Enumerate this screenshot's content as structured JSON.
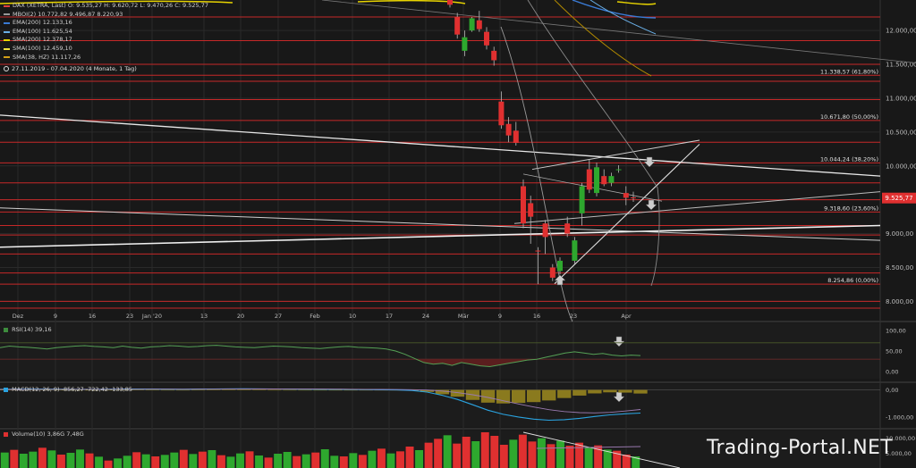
{
  "legend": [
    {
      "label": "DAX (XETRA, Last)  O: 9.535,27  H: 9.620,72  L: 9.470,26  C: 9.525,77",
      "color": "#e04040"
    },
    {
      "label": "MBOI(2)  10.772,82  9.496,87  8.220,93",
      "color": "#999999"
    },
    {
      "label": "EMA(200)  12.133,16",
      "color": "#3a7bd5"
    },
    {
      "label": "EMA(100)  11.625,54",
      "color": "#6ab0e8"
    },
    {
      "label": "SMA(200)  12.378,17",
      "color": "#e8d400"
    },
    {
      "label": "SMA(100)  12.459,10",
      "color": "#f0e040"
    },
    {
      "label": "SMA(38, HZ)  11.117,26",
      "color": "#d4a017"
    }
  ],
  "range_text": "27.11.2019 - 07.04.2020  (4 Monate, 1 Tag)",
  "fib_labels": [
    {
      "text": "11.338,57 (61,80%)",
      "y": 11338.57
    },
    {
      "text": "10.671,80 (50,00%)",
      "y": 10671.8
    },
    {
      "text": "10.044,24 (38,20%)",
      "y": 10044.24
    },
    {
      "text": "9.318,60 (23,60%)",
      "y": 9318.6
    },
    {
      "text": "8.254,86 (0,00%)",
      "y": 8254.86
    }
  ],
  "last_price": {
    "text": "9.525,77",
    "value": 9525.77
  },
  "rsi_title": "RSI(14)  39,16",
  "macd_title": "MACD(12, 26, 9)  -856,27  -722,42  -133,85",
  "volume_title": "Volume(10)  3,86G  7,48G",
  "watermark": "Trading-Portal.NET",
  "colors": {
    "up": "#2ea82e",
    "down": "#e03030",
    "bg": "#181818",
    "grid": "#2a2a2a",
    "hline": "#c62828"
  },
  "chart_data": [
    {
      "type": "candlestick",
      "title": "DAX (XETRA, Last)",
      "x_tick_labels": [
        "Dez",
        "9",
        "16",
        "23",
        "Jan '20",
        "13",
        "20",
        "27",
        "Feb",
        "10",
        "17",
        "24",
        "Mär",
        "9",
        "16",
        "23",
        "Apr"
      ],
      "y_ticks": [
        8000,
        8500,
        9000,
        9500,
        10000,
        10500,
        11000,
        11500,
        12000
      ],
      "y_tick_labels": [
        "8.000,00",
        "8.500,00",
        "9.000,00",
        "9.500,00",
        "10.000,00",
        "10.500,00",
        "11.000,00",
        "11.500,00",
        "12.000,00"
      ],
      "ylim": [
        7900,
        12450
      ],
      "candles": [
        {
          "o": 12510,
          "h": 12560,
          "l": 12340,
          "c": 12380
        },
        {
          "o": 12200,
          "h": 12260,
          "l": 11880,
          "c": 11940
        },
        {
          "o": 11700,
          "h": 12000,
          "l": 11620,
          "c": 11900
        },
        {
          "o": 12000,
          "h": 12200,
          "l": 11980,
          "c": 12180
        },
        {
          "o": 12150,
          "h": 12290,
          "l": 11980,
          "c": 12020
        },
        {
          "o": 11980,
          "h": 12050,
          "l": 11720,
          "c": 11780
        },
        {
          "o": 11700,
          "h": 11760,
          "l": 11480,
          "c": 11560
        },
        {
          "o": 10950,
          "h": 11100,
          "l": 10550,
          "c": 10600
        },
        {
          "o": 10620,
          "h": 10720,
          "l": 10350,
          "c": 10450
        },
        {
          "o": 10520,
          "h": 10650,
          "l": 10300,
          "c": 10340
        },
        {
          "o": 9700,
          "h": 9800,
          "l": 9080,
          "c": 9150
        },
        {
          "o": 9450,
          "h": 9560,
          "l": 8850,
          "c": 9250
        },
        {
          "o": 8750,
          "h": 8800,
          "l": 8255,
          "c": 8740
        },
        {
          "o": 9150,
          "h": 9200,
          "l": 8700,
          "c": 8950
        },
        {
          "o": 8500,
          "h": 8550,
          "l": 8300,
          "c": 8350
        },
        {
          "o": 8450,
          "h": 8650,
          "l": 8400,
          "c": 8600
        },
        {
          "o": 9150,
          "h": 9250,
          "l": 8950,
          "c": 9000
        },
        {
          "o": 8600,
          "h": 8950,
          "l": 8550,
          "c": 8900
        },
        {
          "o": 9300,
          "h": 9750,
          "l": 9120,
          "c": 9700
        },
        {
          "o": 9950,
          "h": 10100,
          "l": 9600,
          "c": 9650
        },
        {
          "o": 9600,
          "h": 10050,
          "l": 9550,
          "c": 9980
        },
        {
          "o": 9850,
          "h": 9950,
          "l": 9700,
          "c": 9730
        },
        {
          "o": 9750,
          "h": 9900,
          "l": 9700,
          "c": 9850
        },
        {
          "o": 9950,
          "h": 10010,
          "l": 9900,
          "c": 9950
        },
        {
          "o": 9600,
          "h": 9700,
          "l": 9420,
          "c": 9530
        },
        {
          "o": 9535,
          "h": 9620,
          "l": 9470,
          "c": 9525
        }
      ],
      "horizontal_levels": [
        12200,
        11850,
        11500,
        11338.57,
        11250,
        10980,
        10671.8,
        10350,
        10044.24,
        9750,
        9500,
        9318.6,
        9120,
        8980,
        8700,
        8420,
        8254.86,
        8000,
        7900
      ]
    },
    {
      "type": "line",
      "title": "RSI(14)",
      "y_tick_labels": [
        "100,00",
        "50,00",
        "0,00"
      ],
      "ylim": [
        0,
        100
      ],
      "series": [
        {
          "name": "RSI(14)",
          "values": [
            58,
            62,
            60,
            59,
            57,
            55,
            58,
            60,
            62,
            63,
            61,
            60,
            58,
            62,
            59,
            57,
            60,
            61,
            63,
            62,
            60,
            61,
            63,
            64,
            62,
            60,
            59,
            58,
            60,
            62,
            61,
            60,
            58,
            57,
            56,
            58,
            60,
            61,
            59,
            58,
            57,
            55,
            50,
            42,
            32,
            22,
            18,
            20,
            15,
            22,
            18,
            14,
            12,
            16,
            20,
            24,
            28,
            30,
            35,
            40,
            45,
            48,
            45,
            42,
            44,
            40,
            38,
            40,
            39
          ]
        }
      ]
    },
    {
      "type": "line",
      "title": "MACD(12, 26, 9)",
      "y_tick_labels": [
        "0,00",
        "-1.000,00"
      ],
      "ylim": [
        -1300,
        150
      ],
      "series": [
        {
          "name": "MACD",
          "values": [
            20,
            25,
            30,
            28,
            25,
            22,
            20,
            25,
            30,
            32,
            30,
            28,
            25,
            30,
            35,
            38,
            40,
            38,
            35,
            30,
            28,
            25,
            20,
            15,
            10,
            5,
            0,
            -20,
            -80,
            -200,
            -350,
            -550,
            -750,
            -900,
            -1000,
            -1080,
            -1120,
            -1100,
            -1050,
            -980,
            -920,
            -880,
            -856
          ]
        },
        {
          "name": "Signal",
          "values": [
            15,
            18,
            20,
            22,
            22,
            22,
            21,
            22,
            24,
            26,
            27,
            27,
            26,
            27,
            29,
            31,
            33,
            34,
            34,
            33,
            32,
            30,
            28,
            25,
            22,
            18,
            15,
            8,
            -5,
            -40,
            -100,
            -180,
            -280,
            -400,
            -520,
            -630,
            -730,
            -800,
            -840,
            -850,
            -830,
            -780,
            -722
          ]
        }
      ]
    },
    {
      "type": "bar",
      "title": "Volume(10)",
      "y_tick_labels": [
        "10.000,00",
        "5.000,00"
      ],
      "ylim": [
        0,
        12000
      ],
      "values": [
        5.2,
        6.1,
        4.8,
        5.5,
        6.8,
        5.9,
        4.5,
        5.1,
        6.2,
        4.9,
        3.8,
        2.5,
        3.2,
        4.1,
        5.3,
        4.6,
        3.9,
        4.4,
        5.2,
        6.1,
        4.7,
        5.5,
        6.0,
        4.3,
        3.8,
        4.9,
        5.6,
        4.2,
        3.5,
        4.8,
        5.4,
        4.0,
        4.6,
        5.2,
        6.3,
        4.1,
        3.9,
        5.0,
        4.4,
        5.8,
        6.5,
        4.9,
        5.6,
        7.2,
        6.0,
        8.5,
        9.8,
        11.0,
        8.2,
        10.5,
        9.0,
        12.0,
        10.8,
        7.8,
        9.5,
        11.2,
        8.9,
        10.0,
        8.0,
        9.2,
        7.5,
        8.5,
        6.8,
        7.6,
        6.2,
        5.8,
        4.5,
        3.9
      ],
      "up": [
        1,
        0,
        1,
        1,
        0,
        1,
        0,
        1,
        1,
        0,
        1,
        0,
        1,
        1,
        0,
        1,
        0,
        1,
        1,
        0,
        1,
        0,
        1,
        0,
        1,
        1,
        0,
        1,
        0,
        1,
        1,
        0,
        1,
        0,
        1,
        1,
        0,
        1,
        0,
        1,
        0,
        1,
        0,
        0,
        1,
        0,
        0,
        1,
        0,
        0,
        1,
        0,
        0,
        0,
        1,
        0,
        0,
        1,
        0,
        1,
        0,
        0,
        1,
        0,
        1,
        0,
        0,
        1
      ]
    }
  ]
}
